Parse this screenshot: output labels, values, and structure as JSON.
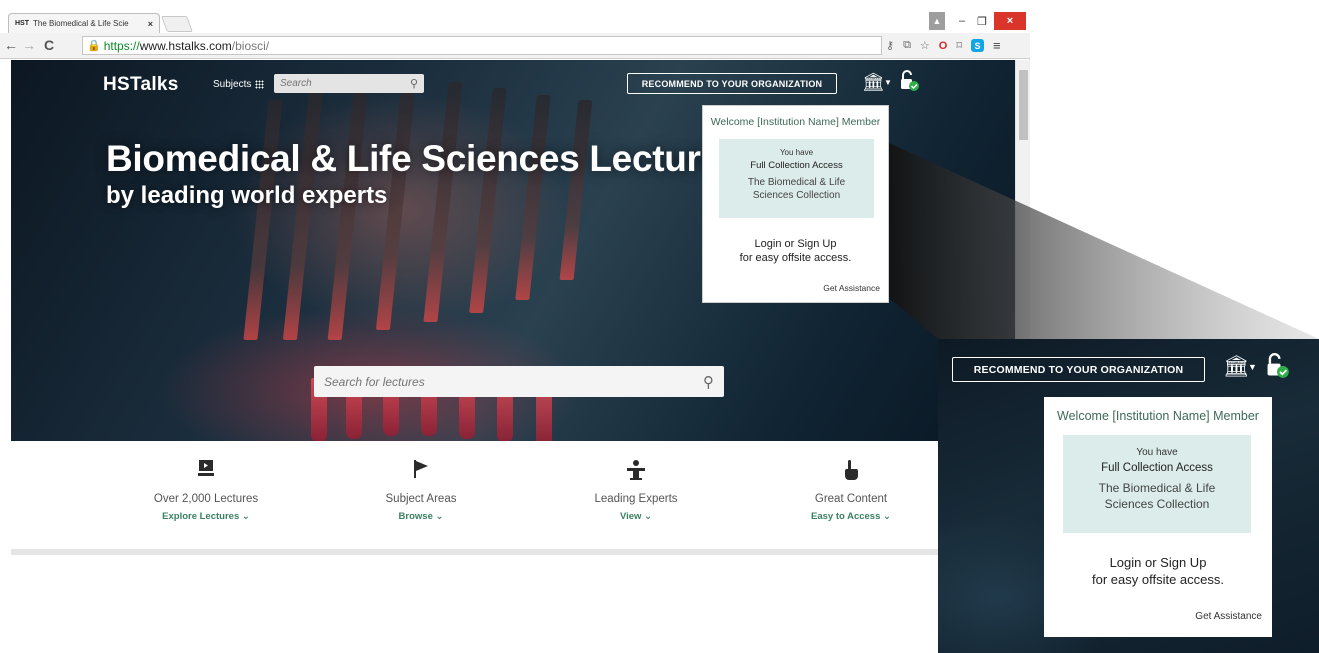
{
  "browser": {
    "tab": {
      "favicon": "HST",
      "title": "The Biomedical & Life Scie",
      "close": "×"
    },
    "controls": {
      "user": "▲",
      "minimize": "–",
      "maximize": "❐",
      "close": "×"
    },
    "nav": {
      "back": "←",
      "forward": "→",
      "reload": "C"
    },
    "url": {
      "scheme": "https://",
      "host": "www.hstalks.com",
      "path": "/biosci/"
    },
    "toolbar_icons": {
      "key": "⚷",
      "translate": "⧉",
      "star": "☆",
      "opera": "O",
      "cast": "⌑",
      "skype": "S",
      "menu": "≡"
    }
  },
  "site": {
    "logo": "HSTalks",
    "subjects_label": "Subjects",
    "top_search_placeholder": "Search",
    "recommend_label": "RECOMMEND TO YOUR ORGANIZATION",
    "hero_title": "Biomedical & Life Sciences Lectures",
    "hero_subtitle": "by leading world experts",
    "main_search_placeholder": "Search for lectures"
  },
  "popover": {
    "welcome": "Welcome [Institution Name] Member",
    "you_have": "You have",
    "access_level": "Full Collection Access",
    "collection": "The Biomedical & Life Sciences Collection",
    "login_line1": "Login or Sign Up",
    "login_line2": "for easy offsite access.",
    "assistance": "Get Assistance"
  },
  "features": [
    {
      "icon": "lecture-screen-icon",
      "title": "Over 2,000 Lectures",
      "link": "Explore Lectures"
    },
    {
      "icon": "flag-icon",
      "title": "Subject Areas",
      "link": "Browse"
    },
    {
      "icon": "lectern-icon",
      "title": "Leading Experts",
      "link": "View"
    },
    {
      "icon": "pointer-hand-icon",
      "title": "Great Content",
      "link": "Easy to Access"
    }
  ],
  "colors": {
    "accent_green": "#3e6a56",
    "link_green": "#3b7f63",
    "access_box": "#dcecea",
    "unlock_badge": "#2fae4a"
  }
}
